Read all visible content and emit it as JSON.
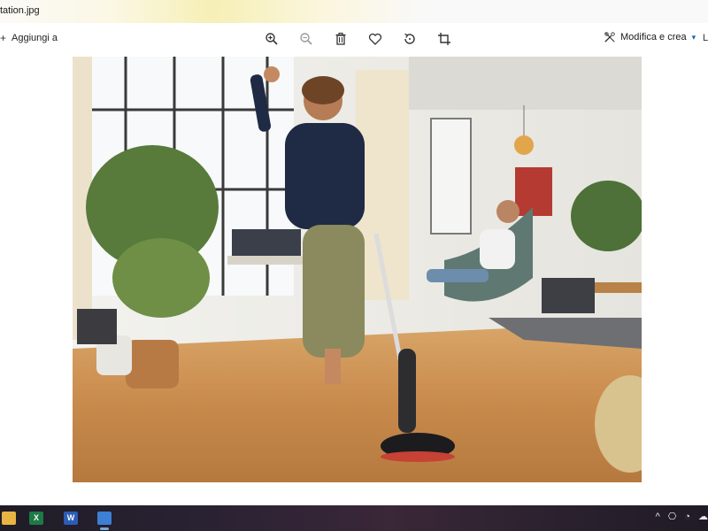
{
  "titlebar": {
    "title": "tation.jpg"
  },
  "toolbar": {
    "add_label": "Aggiungi a",
    "add_glyph": "+",
    "edit_label": "Modifica e crea",
    "edit_chevron": "▾",
    "edge_glyph": "L",
    "icons": [
      "zoom-in-icon",
      "zoom-out-icon",
      "trash-icon",
      "heart-icon",
      "rotate-icon",
      "crop-icon"
    ]
  },
  "photo": {
    "description_icon": "photo-image"
  },
  "taskbar": {
    "apps": [
      {
        "name": "file-explorer",
        "glyph": ""
      },
      {
        "name": "excel",
        "glyph": "X"
      },
      {
        "name": "word",
        "glyph": "W"
      },
      {
        "name": "photos",
        "glyph": ""
      }
    ],
    "tray": {
      "chevron": "^",
      "icons": [
        "meet-icon",
        "wifi-icon",
        "cloud-icon"
      ]
    }
  },
  "colors": {
    "accent": "#1a5fb4",
    "taskbar": "#2a2233",
    "excel": "#1d7a45",
    "word": "#2b5cb8"
  }
}
